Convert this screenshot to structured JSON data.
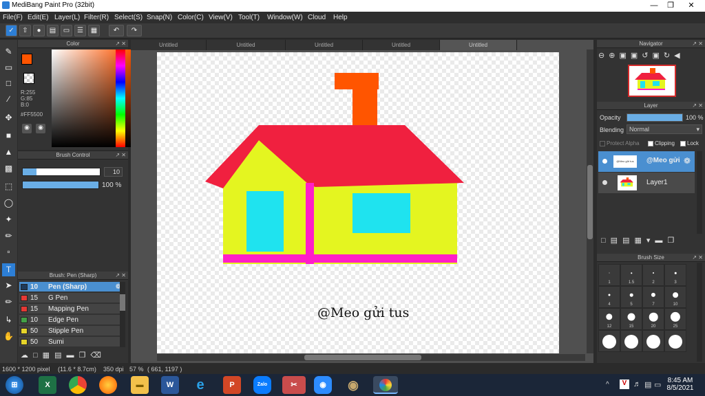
{
  "window": {
    "title": "MediBang Paint Pro (32bit)"
  },
  "menu": [
    "File(F)",
    "Edit(E)",
    "Layer(L)",
    "Filter(R)",
    "Select(S)",
    "Snap(N)",
    "Color(C)",
    "View(V)",
    "Tool(T)",
    "Window(W)",
    "Cloud",
    "Help"
  ],
  "color_panel": {
    "title": "Color",
    "r": "R:255",
    "g": "G:85",
    "b": "B:0",
    "hex": "#FF5500",
    "primary": "#FF5500",
    "secondary": "#FFE100"
  },
  "brush_control": {
    "title": "Brush Control",
    "size": "10",
    "size_fill": 0.18,
    "opacity": "100 %",
    "opacity_fill": 1.0
  },
  "brush_list": {
    "title": "Brush: Pen (Sharp)",
    "items": [
      {
        "size": "10",
        "name": "Pen (Sharp)",
        "color": "#1e3a5a"
      },
      {
        "size": "15",
        "name": "G Pen",
        "color": "#e53935"
      },
      {
        "size": "15",
        "name": "Mapping Pen",
        "color": "#e53935"
      },
      {
        "size": "10",
        "name": "Edge Pen",
        "color": "#43a047"
      },
      {
        "size": "50",
        "name": "Stipple Pen",
        "color": "#e6d42a"
      },
      {
        "size": "50",
        "name": "Sumi",
        "color": "#e6d42a"
      }
    ]
  },
  "doc_tabs": [
    "Untitled",
    "Untitled",
    "Untitled",
    "Untitled",
    "Untitled"
  ],
  "canvas": {
    "caption": "@Meo gửi tus"
  },
  "navigator": {
    "title": "Navigator"
  },
  "layer_panel": {
    "title": "Layer",
    "opacity_label": "Opacity",
    "opacity_value": "100 %",
    "blending_label": "Blending",
    "blending_value": "Normal",
    "protect_alpha": "Protect Alpha",
    "clipping": "Clipping",
    "lock": "Lock",
    "layers": [
      {
        "name": "@Meo gửi",
        "thumb_text": "@Meo gửi tus"
      },
      {
        "name": "Layer1"
      }
    ]
  },
  "brush_size": {
    "title": "Brush Size",
    "sizes": [
      "1",
      "1.5",
      "2",
      "3",
      "4",
      "5",
      "7",
      "10",
      "12",
      "15",
      "20",
      "25",
      "",
      "",
      "",
      ""
    ]
  },
  "status": {
    "pixels": "1600 * 1200 pixel",
    "cm": "(11.6 * 8.7cm)",
    "dpi": "350 dpi",
    "zoom": "57 %",
    "coords": "( 661, 1197 )"
  },
  "taskbar": {
    "time": "8:45 AM",
    "date": "8/5/2021",
    "apps": [
      "Excel",
      "Chrome",
      "Firefox",
      "Explorer",
      "Word",
      "Edge",
      "PowerPoint",
      "Zalo",
      "Snip",
      "Zoom",
      "Paint",
      "MediBang"
    ]
  }
}
